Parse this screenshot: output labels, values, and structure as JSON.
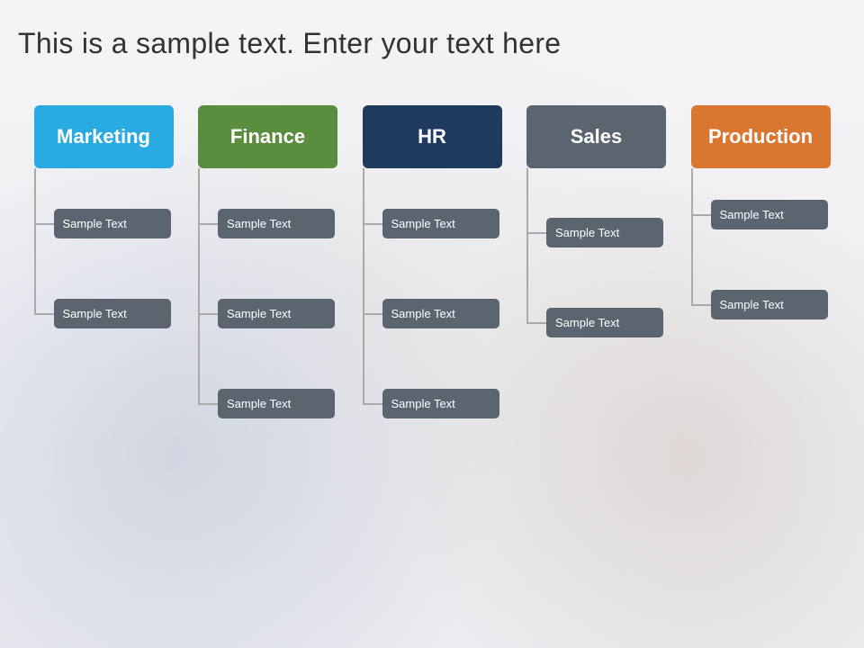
{
  "title": "This is a sample text. Enter your text here",
  "columns": [
    {
      "id": "marketing",
      "label": "Marketing",
      "colorClass": "marketing",
      "items": [
        "Sample Text",
        "Sample Text"
      ]
    },
    {
      "id": "finance",
      "label": "Finance",
      "colorClass": "finance",
      "items": [
        "Sample Text",
        "Sample Text",
        "Sample Text"
      ]
    },
    {
      "id": "hr",
      "label": "HR",
      "colorClass": "hr",
      "items": [
        "Sample Text",
        "Sample Text",
        "Sample Text"
      ]
    },
    {
      "id": "sales",
      "label": "Sales",
      "colorClass": "sales",
      "items": [
        "Sample Text",
        "Sample Text"
      ]
    },
    {
      "id": "production",
      "label": "Production",
      "colorClass": "production",
      "items": [
        "Sample Text",
        "Sample Text"
      ]
    }
  ],
  "node_label": "Sample Text"
}
